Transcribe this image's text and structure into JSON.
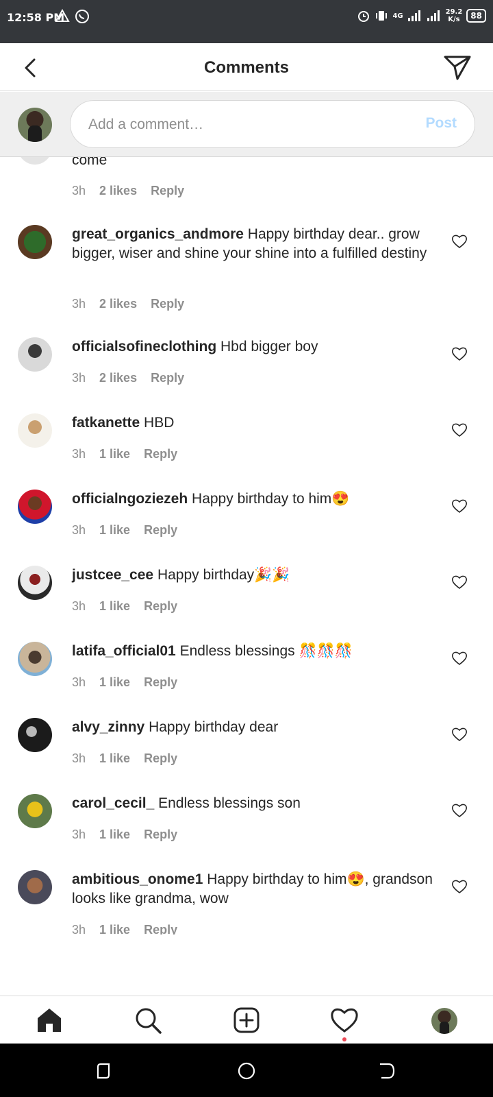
{
  "status_bar": {
    "time": "12:58 PM",
    "network": "4G",
    "speed_value": "29.2",
    "speed_unit": "K/s",
    "battery": "88"
  },
  "header": {
    "title": "Comments"
  },
  "comment_input": {
    "placeholder": "Add a comment…",
    "post_label": "Post"
  },
  "partial_comment": {
    "text_tail": "come",
    "time": "3h",
    "likes": "2 likes",
    "reply": "Reply"
  },
  "comments": [
    {
      "username": "great_organics_andmore",
      "text": "Happy birthday dear.. grow bigger, wiser and shine your shine into a fulfilled destiny",
      "time": "3h",
      "likes": "2 likes",
      "reply": "Reply"
    },
    {
      "username": "officialsofineclothing",
      "text": "Hbd bigger boy",
      "time": "3h",
      "likes": "2 likes",
      "reply": "Reply"
    },
    {
      "username": "fatkanette",
      "text": "HBD",
      "time": "3h",
      "likes": "1 like",
      "reply": "Reply"
    },
    {
      "username": "officialngoziezeh",
      "text": "Happy birthday to him😍",
      "time": "3h",
      "likes": "1 like",
      "reply": "Reply"
    },
    {
      "username": "justcee_cee",
      "text": "Happy birthday🎉🎉",
      "time": "3h",
      "likes": "1 like",
      "reply": "Reply"
    },
    {
      "username": "latifa_official01",
      "text": "Endless blessings 🎊🎊🎊",
      "time": "3h",
      "likes": "1 like",
      "reply": "Reply"
    },
    {
      "username": "alvy_zinny",
      "text": "Happy birthday dear",
      "time": "3h",
      "likes": "1 like",
      "reply": "Reply"
    },
    {
      "username": "carol_cecil_",
      "text": "Endless blessings son",
      "time": "3h",
      "likes": "1 like",
      "reply": "Reply"
    },
    {
      "username": "ambitious_onome1",
      "text": "Happy birthday to him😍, grandson looks like grandma, wow",
      "time": "3h",
      "likes": "1 like",
      "reply": "Reply"
    }
  ],
  "icons": {
    "back": "chevron-left-icon",
    "send": "paper-plane-icon",
    "heart": "heart-outline-icon",
    "nav": [
      "home-icon",
      "search-icon",
      "add-post-icon",
      "activity-heart-icon",
      "profile-avatar"
    ]
  },
  "colors": {
    "status_bar": "#34373b",
    "text": "#262626",
    "muted": "#8e8e8e",
    "post_disabled": "#b3dbff",
    "notification_dot": "#ed4956"
  }
}
